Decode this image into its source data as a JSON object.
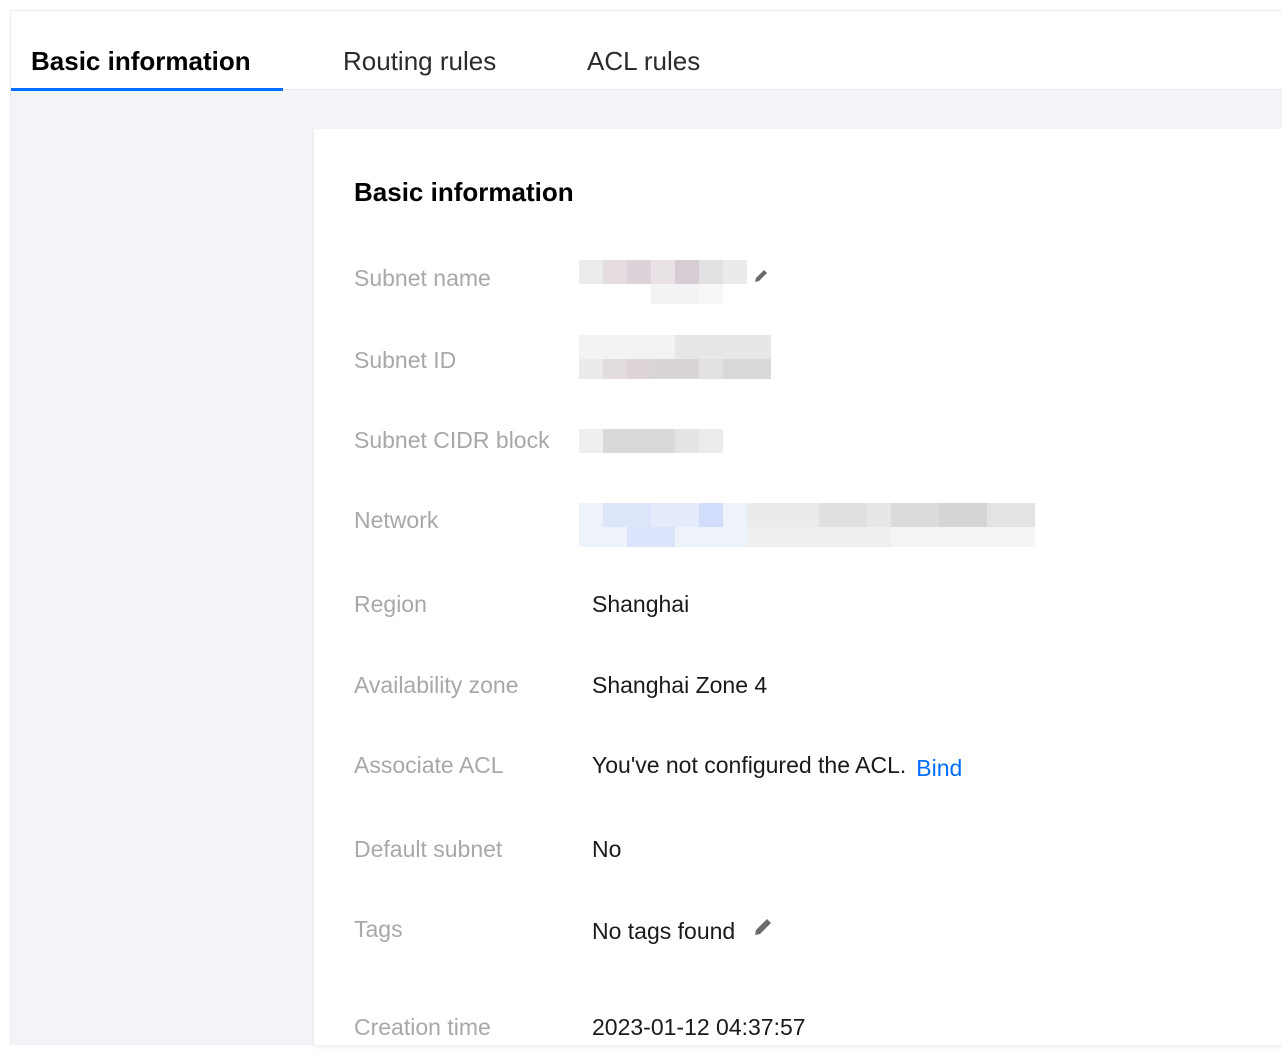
{
  "tabs": [
    {
      "label": "Basic information",
      "active": true
    },
    {
      "label": "Routing rules",
      "active": false
    },
    {
      "label": "ACL rules",
      "active": false
    }
  ],
  "section": {
    "title": "Basic information"
  },
  "fields": {
    "subnet_name": {
      "label": "Subnet name",
      "value": "",
      "redacted": true,
      "edit_icon": "pencil-icon"
    },
    "subnet_id": {
      "label": "Subnet ID",
      "value": "",
      "redacted": true
    },
    "cidr_block": {
      "label": "Subnet CIDR block",
      "value": "",
      "redacted": true
    },
    "network": {
      "label": "Network",
      "value": "",
      "redacted": true
    },
    "region": {
      "label": "Region",
      "value": "Shanghai"
    },
    "availability_zone": {
      "label": "Availability zone",
      "value": "Shanghai Zone 4"
    },
    "associate_acl": {
      "label": "Associate ACL",
      "value": "You've not configured the ACL.",
      "link": "Bind"
    },
    "default_subnet": {
      "label": "Default subnet",
      "value": "No"
    },
    "tags": {
      "label": "Tags",
      "value": "No tags found",
      "edit_icon": "pencil-icon"
    },
    "creation_time": {
      "label": "Creation time",
      "value": "2023-01-12 04:37:57"
    }
  },
  "colors": {
    "accent": "#006eff",
    "label": "#a8a8a8",
    "background": "#f3f4f7",
    "card": "#ffffff"
  }
}
